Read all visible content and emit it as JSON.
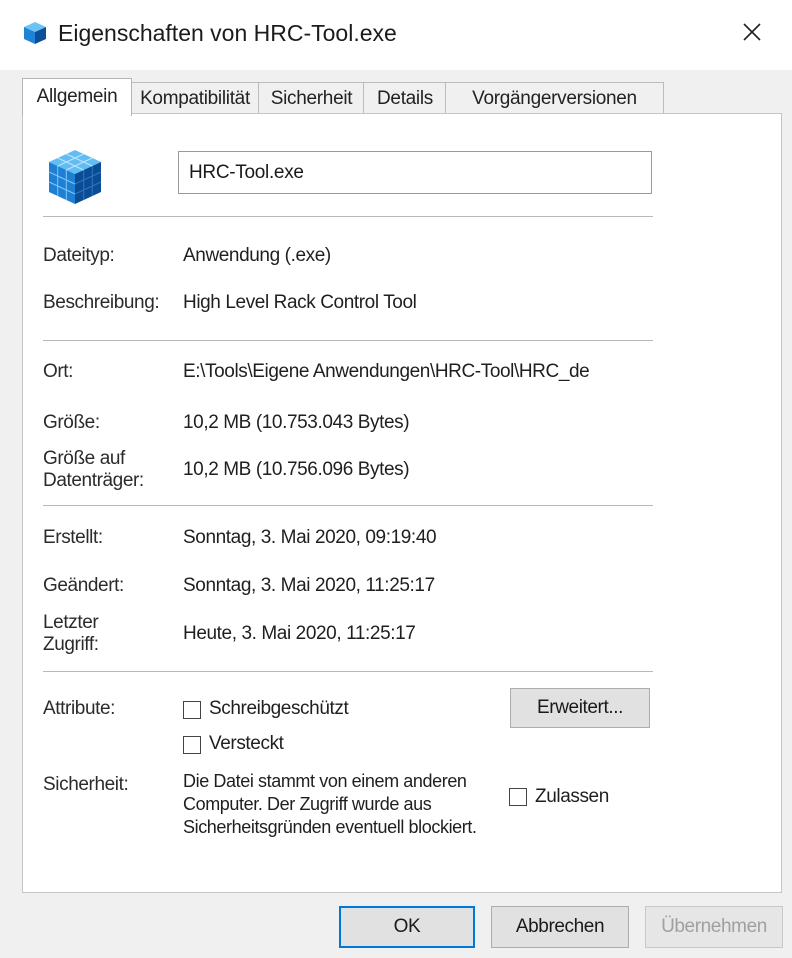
{
  "window": {
    "title": "Eigenschaften von HRC-Tool.exe",
    "close_glyph": "✕",
    "title_icon": "app-cube-icon"
  },
  "tabs": [
    {
      "label": "Allgemein",
      "active": true
    },
    {
      "label": "Kompatibilität",
      "active": false
    },
    {
      "label": "Sicherheit",
      "active": false
    },
    {
      "label": "Details",
      "active": false
    },
    {
      "label": "Vorgängerversionen",
      "active": false
    }
  ],
  "general": {
    "filename": "HRC-Tool.exe",
    "file_type_label": "Dateityp:",
    "file_type": "Anwendung (.exe)",
    "description_label": "Beschreibung:",
    "description": "High Level Rack Control Tool",
    "location_label": "Ort:",
    "location": "E:\\Tools\\Eigene Anwendungen\\HRC-Tool\\HRC_de",
    "size_label": "Größe:",
    "size": "10,2 MB (10.753.043 Bytes)",
    "size_on_disk_label_1": "Größe auf",
    "size_on_disk_label_2": "Datenträger:",
    "size_on_disk": "10,2 MB (10.756.096 Bytes)",
    "created_label": "Erstellt:",
    "created": "Sonntag, 3. Mai 2020, 09:19:40",
    "modified_label": "Geändert:",
    "modified": "Sonntag, 3. Mai 2020, 11:25:17",
    "accessed_label_1": "Letzter",
    "accessed_label_2": "Zugriff:",
    "accessed": "Heute, 3. Mai 2020, 11:25:17",
    "attributes_label": "Attribute:",
    "readonly_label": "Schreibgeschützt",
    "readonly_checked": false,
    "hidden_label": "Versteckt",
    "hidden_checked": false,
    "advanced_button": "Erweitert...",
    "security_label": "Sicherheit:",
    "security_text": "Die Datei stammt von einem anderen Computer. Der Zugriff wurde aus Sicherheitsgründen eventuell blockiert.",
    "unblock_label": "Zulassen",
    "unblock_checked": false
  },
  "footer": {
    "ok": "OK",
    "cancel": "Abbrechen",
    "apply": "Übernehmen"
  },
  "colors": {
    "accent": "#0078d7",
    "cube_top": "#5fb8f0",
    "cube_left": "#1f7fd0",
    "cube_right": "#0b4f9a"
  }
}
